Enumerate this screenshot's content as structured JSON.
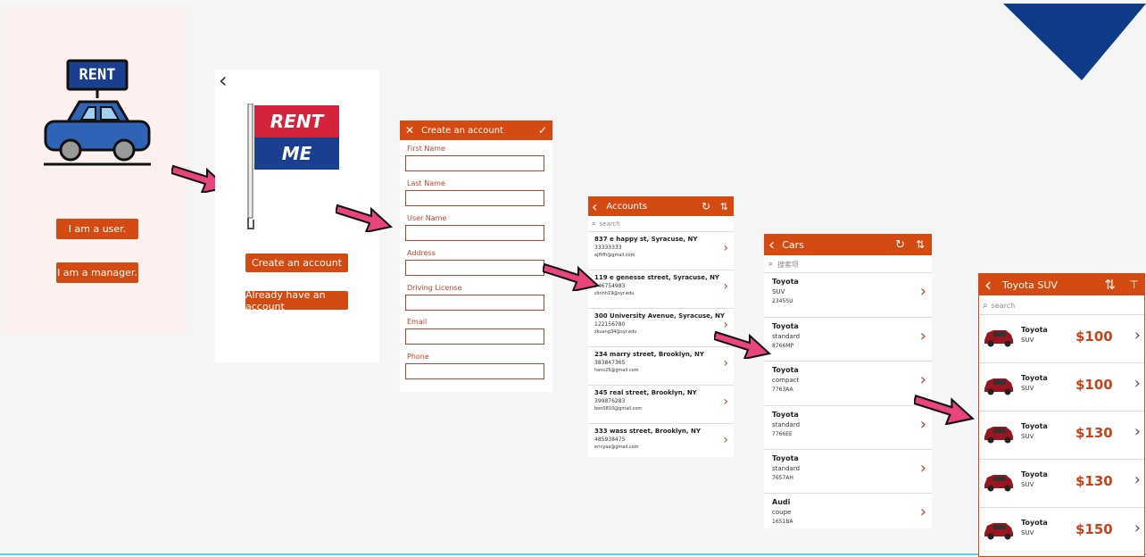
{
  "welcome": {
    "sign_text": "RENT",
    "user_button": "I am a user.",
    "manager_button": "I am a manager."
  },
  "start": {
    "flag_line1": "RENT",
    "flag_line2": "ME",
    "create_button": "Create an account",
    "existing_button": "Already have an account"
  },
  "create": {
    "title": "Create an account",
    "fields": [
      "First Name",
      "Last Name",
      "User Name",
      "Address",
      "Driving License",
      "Email",
      "Phone"
    ]
  },
  "accounts": {
    "title": "Accounts",
    "search_placeholder": "search",
    "items": [
      {
        "address": "837 e happy st, Syracuse, NY",
        "phone": "33333333",
        "email": "ajfhfh@gmail.com"
      },
      {
        "address": "119 e genesse street, Syracuse, NY",
        "phone": "746754983",
        "email": "zlinhh19@syr.edu"
      },
      {
        "address": "300 University Avenue, Syracuse, NY",
        "phone": "122156780",
        "email": "zkuang34@syr.edu"
      },
      {
        "address": "234 marry street, Brooklyn, NY",
        "phone": "383847365",
        "email": "hans25@gmail.com"
      },
      {
        "address": "345 real street, Brooklyn, NY",
        "phone": "399876283",
        "email": "ben0810@gmail.com"
      },
      {
        "address": "333 wass street, Brooklyn, NY",
        "phone": "485938475",
        "email": "ericyaa@gmail.com"
      }
    ]
  },
  "cars": {
    "title": "Cars",
    "search_placeholder": "搜索项",
    "items": [
      {
        "make": "Toyota",
        "type": "SUV",
        "id": "2345SU"
      },
      {
        "make": "Toyota",
        "type": "standard",
        "id": "8766MP"
      },
      {
        "make": "Toyota",
        "type": "compact",
        "id": "7763AA"
      },
      {
        "make": "Toyota",
        "type": "standard",
        "id": "7766EE"
      },
      {
        "make": "Toyota",
        "type": "standard",
        "id": "7657AH"
      },
      {
        "make": "Audi",
        "type": "coupe",
        "id": "1651BA"
      }
    ]
  },
  "suv": {
    "title": "Toyota SUV",
    "search_placeholder": "search",
    "items": [
      {
        "make": "Toyota",
        "type": "SUV",
        "price": "$100"
      },
      {
        "make": "Toyota",
        "type": "SUV",
        "price": "$100"
      },
      {
        "make": "Toyota",
        "type": "SUV",
        "price": "$130"
      },
      {
        "make": "Toyota",
        "type": "SUV",
        "price": "$130"
      },
      {
        "make": "Toyota",
        "type": "SUV",
        "price": "$150"
      }
    ]
  },
  "colors": {
    "accent": "#d34a12",
    "arrow": "#e8457a",
    "corner": "#0f3a88",
    "flag_red": "#d4233b",
    "flag_blue": "#1a3f8f"
  }
}
